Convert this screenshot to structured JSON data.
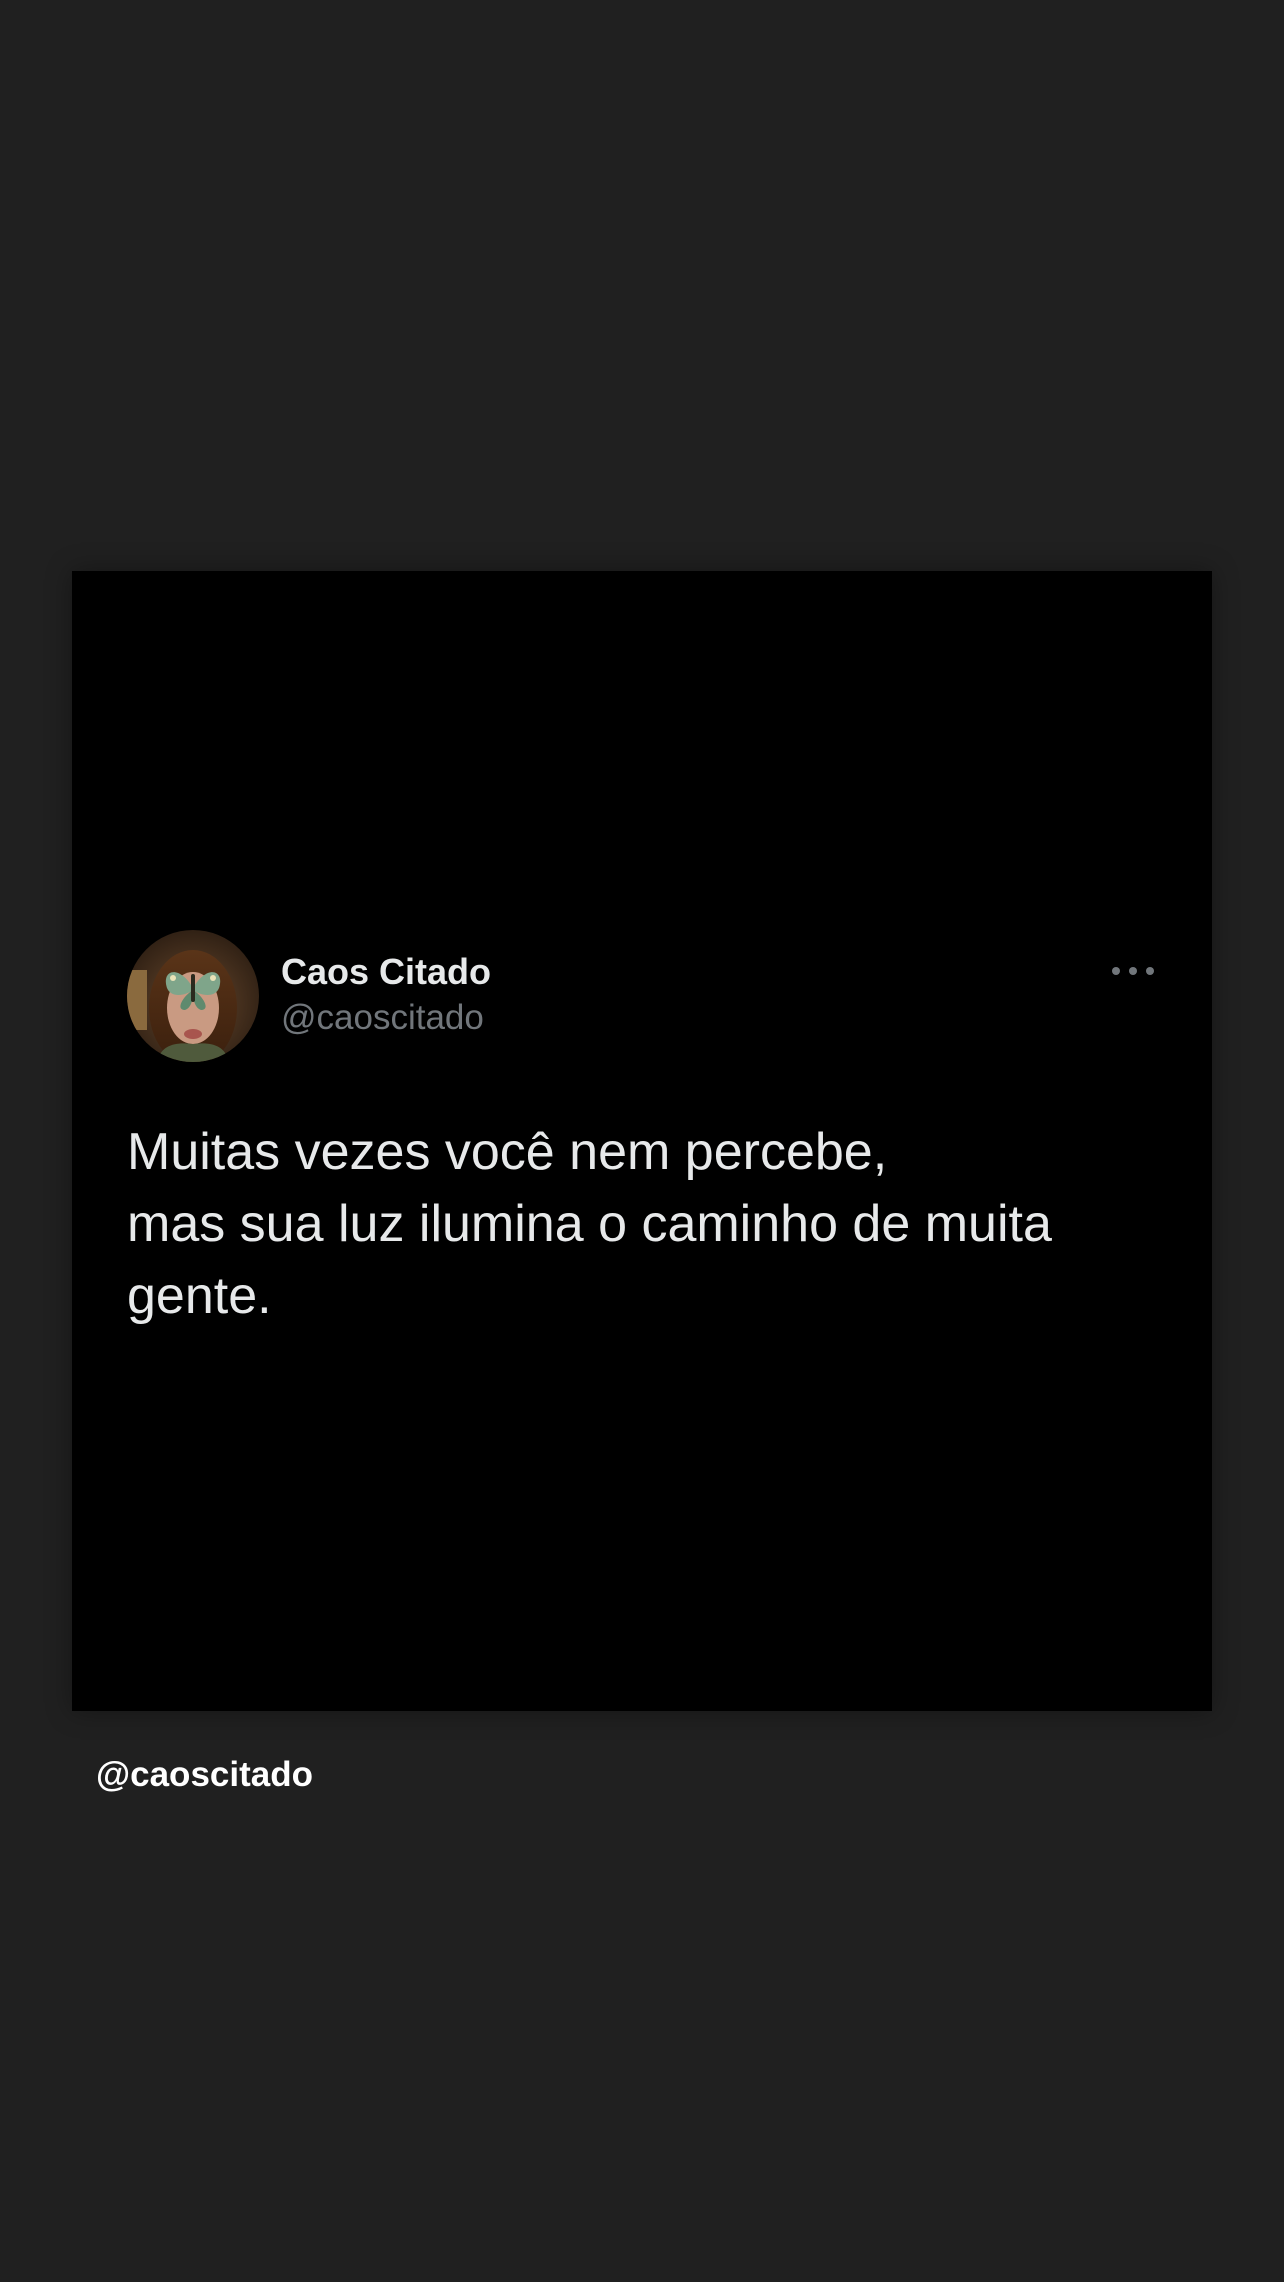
{
  "tweet": {
    "display_name": "Caos Citado",
    "handle": "@caoscitado",
    "text": "Muitas vezes você nem percebe,\nmas sua luz ilumina o caminho de muita gente.",
    "more_icon": "more-horizontal-icon",
    "avatar_icon": "profile-avatar"
  },
  "footer": {
    "handle": "@caoscitado"
  },
  "colors": {
    "background": "#202020",
    "card": "#000000",
    "primary_text": "#e7e9ea",
    "secondary_text": "#71767b"
  }
}
